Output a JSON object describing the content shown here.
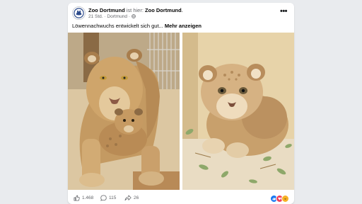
{
  "post": {
    "page_name": "Zoo Dortmund",
    "connector": "ist hier:",
    "location_name": "Zoo Dortmund",
    "period": ".",
    "time": "21 Std.",
    "separator": "·",
    "location_meta": "Dortmund",
    "separator2": "·",
    "privacy_icon": "globe-icon",
    "text": "Löwennachwuchs entwickelt sich gut...",
    "more_label": "Mehr anzeigen",
    "more_options_icon": "ellipsis-icon"
  },
  "images": [
    {
      "name": "lioness-with-cub-photo"
    },
    {
      "name": "lion-cub-photo"
    }
  ],
  "footer": {
    "likes": "1.468",
    "comments": "115",
    "shares": "26",
    "like_icon": "thumbs-up-icon",
    "comment_icon": "comment-icon",
    "share_icon": "share-icon",
    "reaction_icons": [
      "like-reaction-icon",
      "love-reaction-icon",
      "haha-reaction-icon"
    ]
  },
  "colors": {
    "page_background": "#e9ebee",
    "card_background": "#ffffff",
    "text_primary": "#050505",
    "text_secondary": "#65676b",
    "like_blue": "#1877f2",
    "love_red": "#f33e58",
    "haha_yellow": "#f7b125"
  }
}
